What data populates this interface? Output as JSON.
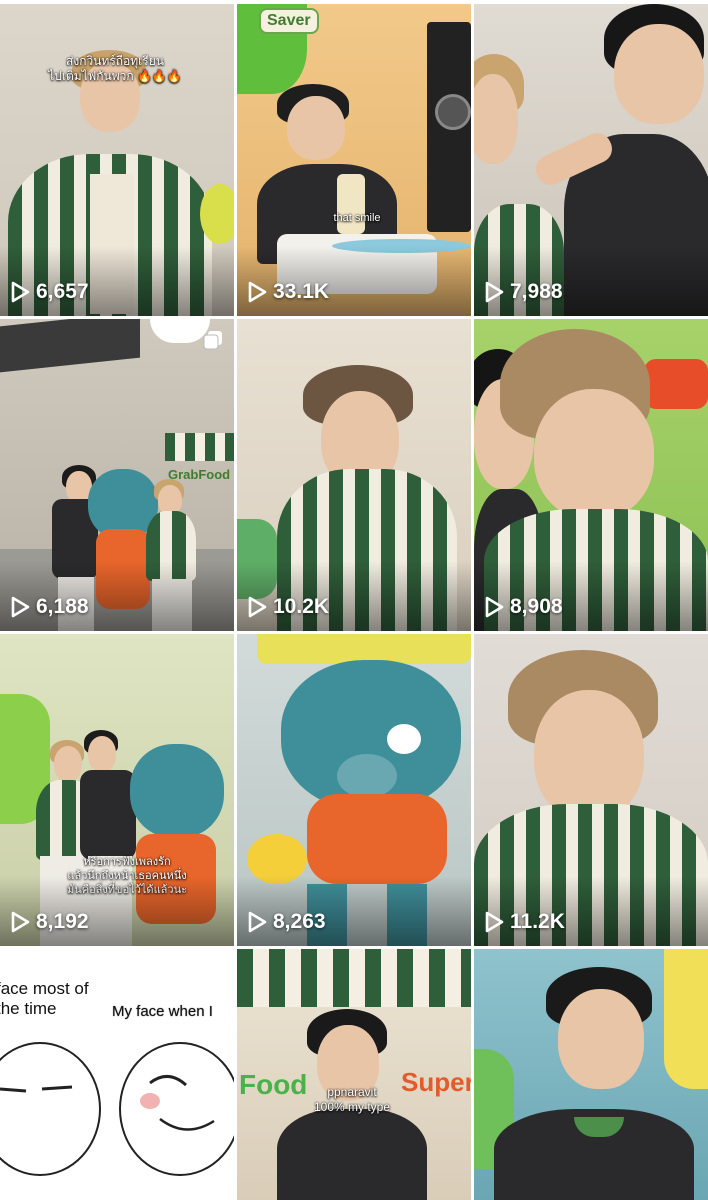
{
  "grid": {
    "tiles": [
      {
        "views": "6,657",
        "caption": "ส่งกวินทร์ถือทุเรียน\nไปเติมไฟกันพวก 🔥🔥🔥",
        "bg": "#d9d2c6"
      },
      {
        "views": "33.1K",
        "caption": "that smile",
        "sign": "Saver",
        "bg": "#f0c07a"
      },
      {
        "views": "7,988",
        "caption": "",
        "bg": "#d8d4cc"
      },
      {
        "views": "6,188",
        "caption": "",
        "sign": "GrabFood",
        "bg": "#c9c2b6"
      },
      {
        "views": "10.2K",
        "caption": "",
        "bg": "#e4dccd"
      },
      {
        "views": "8,908",
        "caption": "",
        "bg": "#cfd9c2"
      },
      {
        "views": "8,192",
        "caption": "หรือการฟังเพลงรัก\nแล้วนึกถึงหน้าเธอคนหนึ่ง\nมันคือสิ่งที่ขอไว้ได้แล้วนะ",
        "bg": "#d7dbb8"
      },
      {
        "views": "8,263",
        "caption": "",
        "bg": "#c9d5d6"
      },
      {
        "views": "11.2K",
        "caption": "",
        "bg": "#dcd6cf"
      },
      {
        "views": "",
        "caption": "face most of\nthe time",
        "caption2": "My face when I",
        "bg": "#ffffff"
      },
      {
        "views": "",
        "caption": "ppnaravit\n100% my type",
        "sign": "Food",
        "sign2": "Super",
        "bg": "#e9e0cf"
      },
      {
        "views": "",
        "caption": "",
        "bg": "#7fb7c2"
      }
    ]
  },
  "icons": {
    "play": "play-icon",
    "multi": "multiple-photos-icon"
  },
  "colors": {
    "green": "#2f5e3a",
    "cream": "#f1ece0",
    "accent_orange": "#e8652b"
  }
}
